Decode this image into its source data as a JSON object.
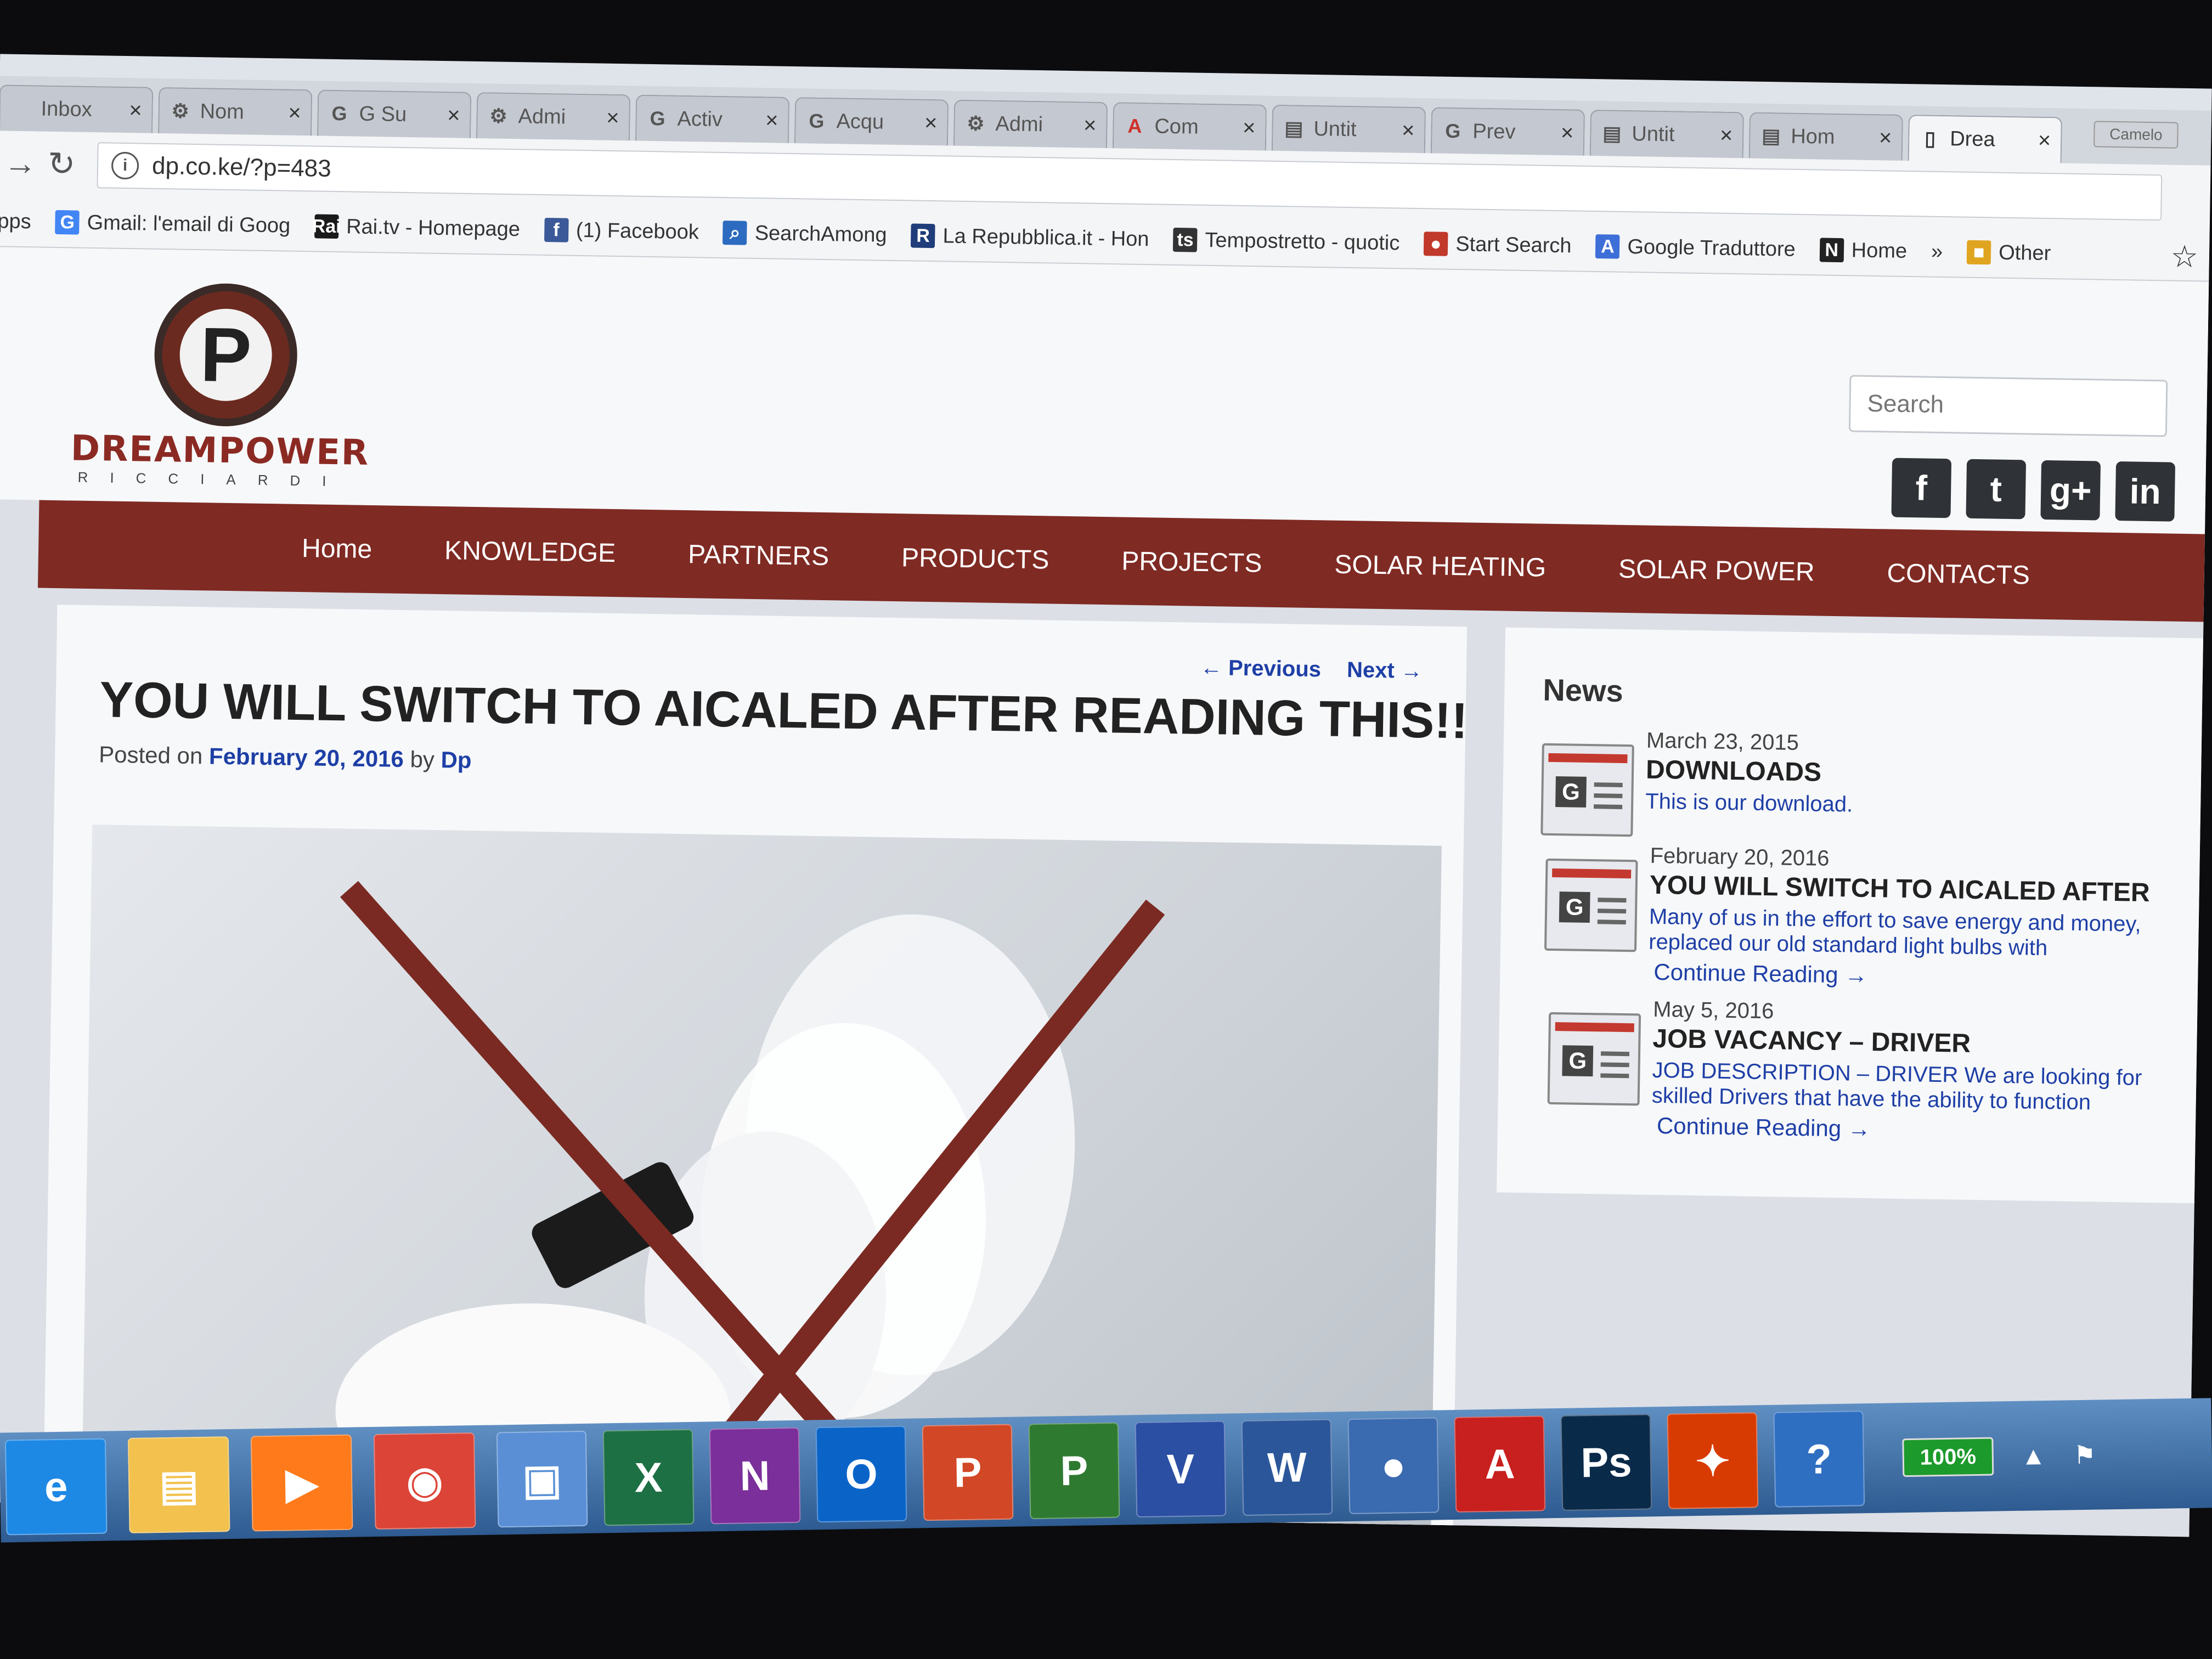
{
  "browser": {
    "tabs": [
      {
        "label": "Inbox",
        "icon": "mail-icon"
      },
      {
        "label": "Nom",
        "icon": "wordpress-icon"
      },
      {
        "label": "G Su",
        "icon": "google-icon"
      },
      {
        "label": "Admi",
        "icon": "wordpress-icon"
      },
      {
        "label": "Activ",
        "icon": "google-icon"
      },
      {
        "label": "Acqu",
        "icon": "google-icon"
      },
      {
        "label": "Admi",
        "icon": "wordpress-icon"
      },
      {
        "label": "Com",
        "icon": "acrobat-icon"
      },
      {
        "label": "Untit",
        "icon": "page-layout-icon"
      },
      {
        "label": "Prev",
        "icon": "google-icon"
      },
      {
        "label": "Untit",
        "icon": "page-layout-icon"
      },
      {
        "label": "Hom",
        "icon": "page-layout-icon"
      },
      {
        "label": "Drea",
        "icon": "document-icon",
        "active": true
      }
    ],
    "window_label": "Camelo",
    "url": "dp.co.ke/?p=483",
    "bookmarks": [
      {
        "label": "pps",
        "icon": ""
      },
      {
        "label": "Gmail: l'email di Goog",
        "icon": "G",
        "color": "#4285f4"
      },
      {
        "label": "Rai.tv - Homepage",
        "icon": "Rai",
        "color": "#1a1a1a"
      },
      {
        "label": "(1) Facebook",
        "icon": "f",
        "color": "#3b5998"
      },
      {
        "label": "SearchAmong",
        "icon": "⌕",
        "color": "#2c6bbf"
      },
      {
        "label": "La Repubblica.it - Hon",
        "icon": "R",
        "color": "#1f3d7a"
      },
      {
        "label": "Tempostretto - quotic",
        "icon": "ts",
        "color": "#333"
      },
      {
        "label": "Start Search",
        "icon": "●",
        "color": "#c0392b"
      },
      {
        "label": "Google Traduttore",
        "icon": "A",
        "color": "#3e6fd8"
      },
      {
        "label": "Home",
        "icon": "N",
        "color": "#222"
      },
      {
        "label": "»",
        "icon": ""
      },
      {
        "label": "Other",
        "icon": "■",
        "color": "#e0a520"
      }
    ]
  },
  "site": {
    "logo_word": "DREAMPOWER",
    "logo_sub": "RICCIARDI",
    "logo_letter": "P",
    "search_placeholder": "Search",
    "social": [
      "f",
      "t",
      "g+",
      "in"
    ],
    "menu": [
      "Home",
      "KNOWLEDGE",
      "PARTNERS",
      "PRODUCTS",
      "PROJECTS",
      "SOLAR HEATING",
      "SOLAR POWER",
      "CONTACTS"
    ]
  },
  "post": {
    "prev_label": "← Previous",
    "next_label": "Next →",
    "title": "YOU WILL SWITCH TO AICALED AFTER READING THIS!!",
    "posted_on": "Posted on",
    "date": "February 20, 2016",
    "by": "by",
    "author": "Dp"
  },
  "sidebar": {
    "title": "News",
    "items": [
      {
        "date": "March 23, 2015",
        "title": "DOWNLOADS",
        "desc": "This is our download.",
        "more": ""
      },
      {
        "date": "February 20, 2016",
        "title": "YOU WILL SWITCH TO AICALED AFTER",
        "desc": "Many of us in the effort to save energy and money, replaced our old standard light bulbs with",
        "more": "Continue Reading →"
      },
      {
        "date": "May 5, 2016",
        "title": "JOB VACANCY – DRIVER",
        "desc": "JOB DESCRIPTION – DRIVER   We are looking for skilled Drivers that have the ability to function",
        "more": "Continue Reading →"
      }
    ]
  },
  "taskbar": {
    "apps": [
      {
        "label": "e",
        "name": "internet-explorer-icon",
        "color": "#1e88e5"
      },
      {
        "label": "▤",
        "name": "file-explorer-icon",
        "color": "#f2c14e"
      },
      {
        "label": "▶",
        "name": "media-player-icon",
        "color": "#ff7a1a"
      },
      {
        "label": "◉",
        "name": "chrome-icon",
        "color": "#db4437"
      },
      {
        "label": "▣",
        "name": "store-icon",
        "color": "#5a8fd6"
      },
      {
        "label": "X",
        "name": "excel-icon",
        "color": "#1d7044"
      },
      {
        "label": "N",
        "name": "onenote-icon",
        "color": "#7b2f9a"
      },
      {
        "label": "O",
        "name": "outlook-icon",
        "color": "#0a64c8"
      },
      {
        "label": "P",
        "name": "powerpoint-icon",
        "color": "#d24726"
      },
      {
        "label": "P",
        "name": "project-icon",
        "color": "#2f7a31"
      },
      {
        "label": "V",
        "name": "visio-icon",
        "color": "#2b4fa3"
      },
      {
        "label": "W",
        "name": "word-icon",
        "color": "#2b579a"
      },
      {
        "label": "●",
        "name": "thunderbird-icon",
        "color": "#3a6ab0"
      },
      {
        "label": "A",
        "name": "acrobat-icon",
        "color": "#c8201e"
      },
      {
        "label": "Ps",
        "name": "photoshop-icon",
        "color": "#0a2a4a"
      },
      {
        "label": "✦",
        "name": "office-icon",
        "color": "#d83b01"
      },
      {
        "label": "?",
        "name": "help-icon",
        "color": "#2f6fc2"
      }
    ],
    "battery": "100%"
  }
}
